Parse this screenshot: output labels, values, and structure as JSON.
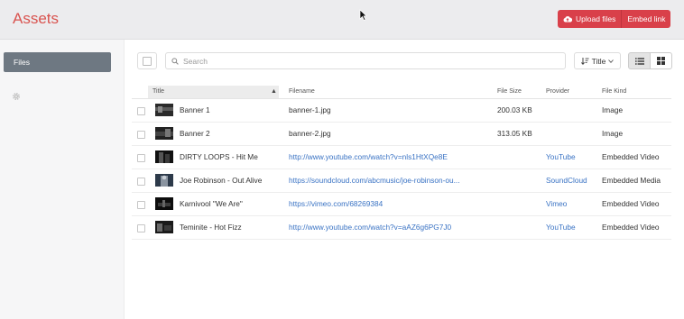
{
  "header": {
    "title": "Assets",
    "upload_label": "Upload files",
    "embed_label": "Embed link"
  },
  "sidebar": {
    "files_label": "Files"
  },
  "toolbar": {
    "search_placeholder": "Search",
    "sort_label": "Title"
  },
  "table": {
    "columns": {
      "title": "Title",
      "filename": "Filename",
      "filesize": "File Size",
      "provider": "Provider",
      "filekind": "File Kind"
    },
    "rows": [
      {
        "title": "Banner 1",
        "filename": "banner-1.jpg",
        "filesize": "200.03 KB",
        "provider": "",
        "filekind": "Image",
        "is_link": false
      },
      {
        "title": "Banner 2",
        "filename": "banner-2.jpg",
        "filesize": "313.05 KB",
        "provider": "",
        "filekind": "Image",
        "is_link": false
      },
      {
        "title": "DIRTY LOOPS - Hit Me",
        "filename": "http://www.youtube.com/watch?v=nls1HtXQe8E",
        "filesize": "",
        "provider": "YouTube",
        "filekind": "Embedded Video",
        "is_link": true
      },
      {
        "title": "Joe Robinson - Out Alive",
        "filename": "https://soundcloud.com/abcmusic/joe-robinson-ou...",
        "filesize": "",
        "provider": "SoundCloud",
        "filekind": "Embedded Media",
        "is_link": true
      },
      {
        "title": "Karnivool \"We Are\"",
        "filename": "https://vimeo.com/68269384",
        "filesize": "",
        "provider": "Vimeo",
        "filekind": "Embedded Video",
        "is_link": true
      },
      {
        "title": "Teminite - Hot Fizz",
        "filename": "http://www.youtube.com/watch?v=aAZ6g6PG7J0",
        "filesize": "",
        "provider": "YouTube",
        "filekind": "Embedded Video",
        "is_link": true
      }
    ]
  }
}
